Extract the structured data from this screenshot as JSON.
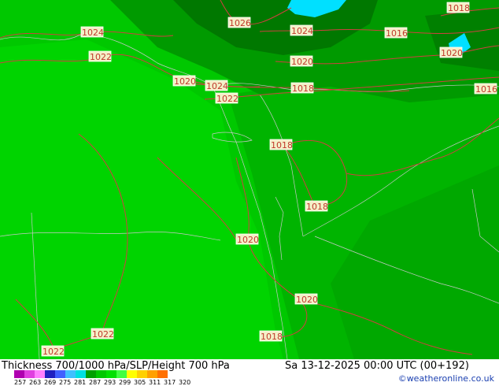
{
  "map": {
    "isobar_labels": [
      "1024",
      "1026",
      "1018",
      "1022",
      "1024",
      "1016",
      "1020",
      "1020",
      "1024",
      "1022",
      "1018",
      "1018",
      "1020",
      "1018",
      "1020",
      "1022",
      "1022",
      "1018",
      "1016",
      "1020"
    ]
  },
  "footer": {
    "title": "Thickness 700/1000 hPa/SLP/Height 700 hPa",
    "datetime": "Sa 13-12-2025 00:00 UTC (00+192)",
    "credit": "©weatheronline.co.uk",
    "legend_ticks": [
      "257",
      "263",
      "269",
      "275",
      "281",
      "287",
      "293",
      "299",
      "305",
      "311",
      "317",
      "320"
    ],
    "legend_colors": [
      "#b000b0",
      "#e040e0",
      "#ff80ff",
      "#2020c0",
      "#4060ff",
      "#40c0ff",
      "#00e0e0",
      "#00a000",
      "#00c800",
      "#00e000",
      "#40ff40",
      "#ffff00",
      "#ffd000",
      "#ffa000",
      "#ff7000"
    ]
  },
  "colors": {
    "bg_green": "#00c800",
    "mid_green": "#00a800",
    "dark_green": "#008c00",
    "darkest_green": "#006e00",
    "water_cyan": "#00e0ff",
    "isobar_red": "#d04040",
    "border_gray": "#c8c8c8"
  }
}
